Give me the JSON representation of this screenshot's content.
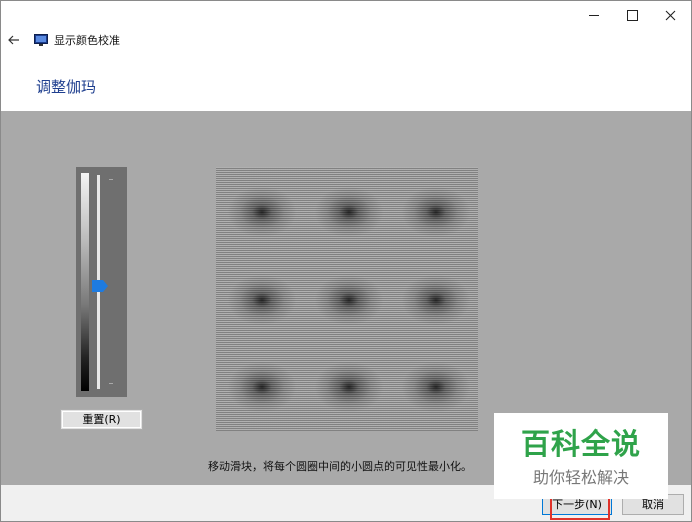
{
  "window": {
    "title": "显示颜色校准"
  },
  "page": {
    "title": "调整伽玛"
  },
  "slider": {
    "reset_label": "重置(R)"
  },
  "instruction": "移动滑块，将每个圆圈中间的小圆点的可见性最小化。",
  "footer": {
    "next_label": "下一步(N)",
    "cancel_label": "取消"
  },
  "watermark": {
    "title": "百科全说",
    "subtitle": "助你轻松解决"
  },
  "colors": {
    "title_blue": "#1f3f8f",
    "content_gray": "#a9a9a9",
    "accent": "#0078d7",
    "highlight_red": "#e0322a",
    "watermark_green": "#2fa34a"
  },
  "icons": {
    "back": "back-arrow-icon",
    "app": "display-monitor-icon",
    "minimize": "minimize-icon",
    "maximize": "maximize-icon",
    "close": "close-icon"
  }
}
